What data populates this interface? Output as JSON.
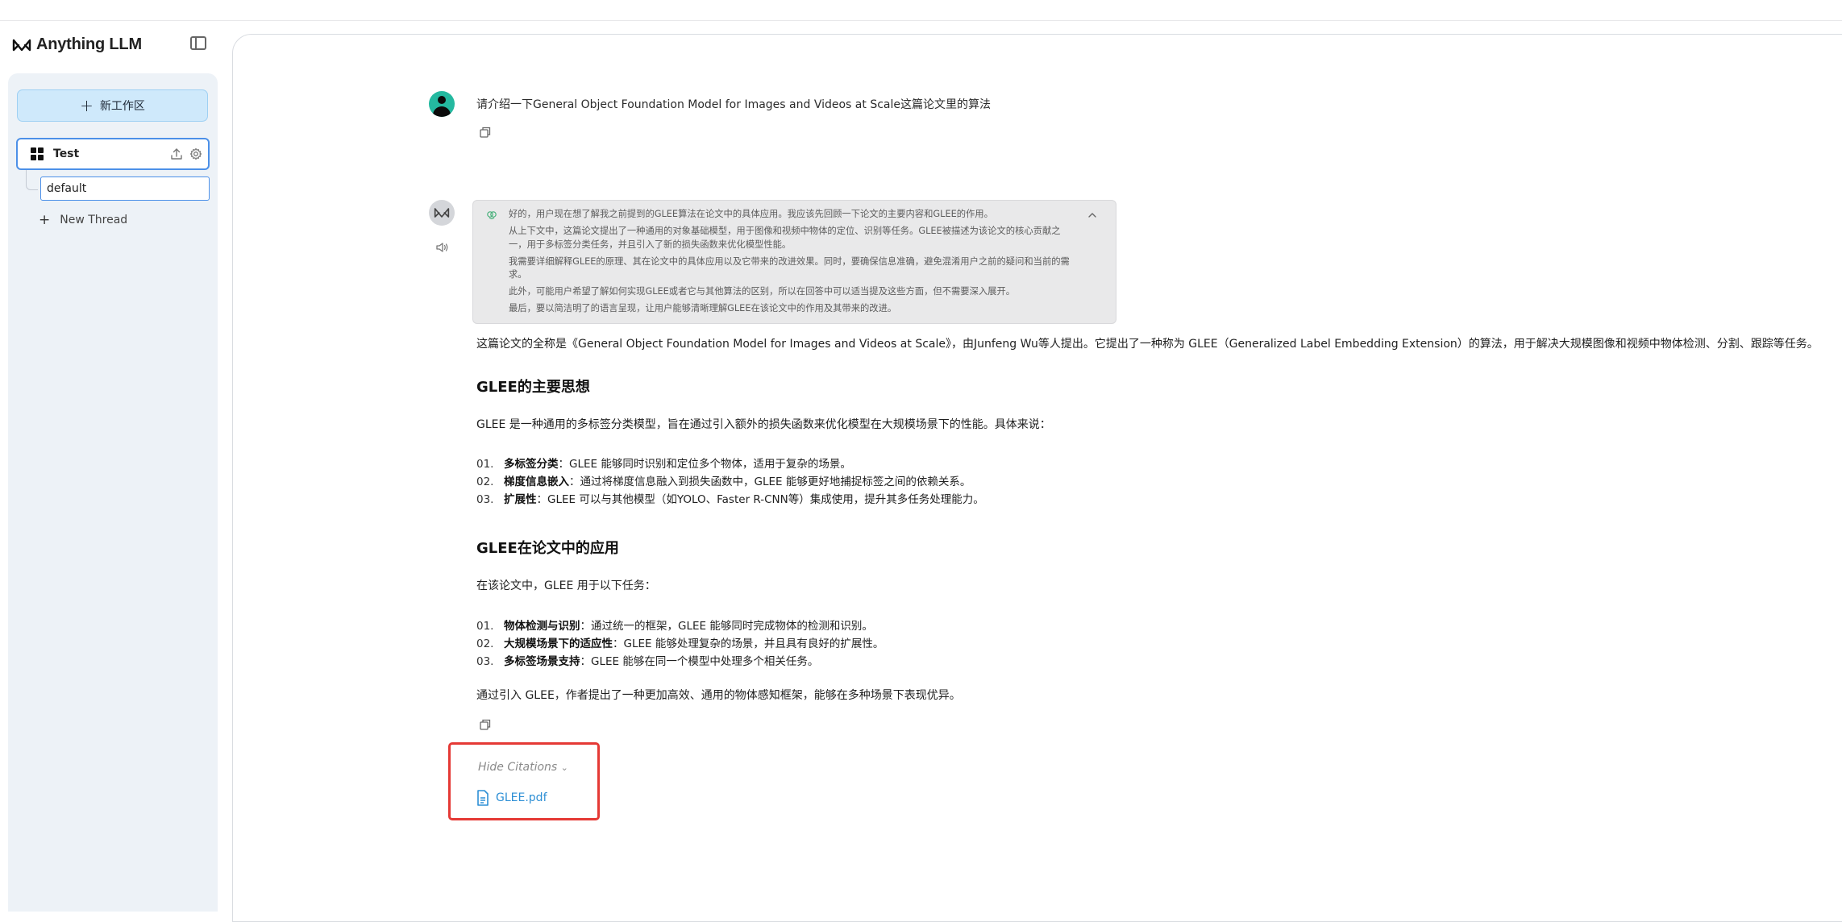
{
  "app": {
    "name": "Anything LLM"
  },
  "sidebar": {
    "new_workspace_label": "新工作区",
    "workspace": {
      "name": "Test"
    },
    "threads": [
      {
        "name": "default"
      }
    ],
    "new_thread_label": "New Thread"
  },
  "chat": {
    "user_message": "请介绍一下General Object Foundation Model for Images and Videos at Scale这篇论文里的算法",
    "thinking": [
      "好的，用户现在想了解我之前提到的GLEE算法在论文中的具体应用。我应该先回顾一下论文的主要内容和GLEE的作用。",
      "从上下文中，这篇论文提出了一种通用的对象基础模型，用于图像和视频中物体的定位、识别等任务。GLEE被描述为该论文的核心贡献之一，用于多标签分类任务，并且引入了新的损失函数来优化模型性能。",
      "我需要详细解释GLEE的原理、其在论文中的具体应用以及它带来的改进效果。同时，要确保信息准确，避免混淆用户之前的疑问和当前的需求。",
      "此外，可能用户希望了解如何实现GLEE或者它与其他算法的区别，所以在回答中可以适当提及这些方面，但不需要深入展开。",
      "最后，要以简洁明了的语言呈现，让用户能够清晰理解GLEE在该论文中的作用及其带来的改进。"
    ],
    "intro": "这篇论文的全称是《General Object Foundation Model for Images and Videos at Scale》，由Junfeng Wu等人提出。它提出了一种称为 GLEE（Generalized Label Embedding Extension）的算法，用于解决大规模图像和视频中物体检测、分割、跟踪等任务。",
    "section1": {
      "title": "GLEE的主要思想",
      "lead": "GLEE 是一种通用的多标签分类模型，旨在通过引入额外的损失函数来优化模型在大规模场景下的性能。具体来说：",
      "items": [
        {
          "num": "01.",
          "bold": "多标签分类",
          "text": "：GLEE 能够同时识别和定位多个物体，适用于复杂的场景。"
        },
        {
          "num": "02.",
          "bold": "梯度信息嵌入",
          "text": "：通过将梯度信息融入到损失函数中，GLEE 能够更好地捕捉标签之间的依赖关系。"
        },
        {
          "num": "03.",
          "bold": "扩展性",
          "text": "：GLEE 可以与其他模型（如YOLO、Faster R-CNN等）集成使用，提升其多任务处理能力。"
        }
      ]
    },
    "section2": {
      "title": "GLEE在论文中的应用",
      "lead": "在该论文中，GLEE 用于以下任务：",
      "items": [
        {
          "num": "01.",
          "bold": "物体检测与识别",
          "text": "：通过统一的框架，GLEE 能够同时完成物体的检测和识别。"
        },
        {
          "num": "02.",
          "bold": "大规模场景下的适应性",
          "text": "：GLEE 能够处理复杂的场景，并且具有良好的扩展性。"
        },
        {
          "num": "03.",
          "bold": "多标签场景支持",
          "text": "：GLEE 能够在同一个模型中处理多个相关任务。"
        }
      ]
    },
    "conclusion": "通过引入 GLEE，作者提出了一种更加高效、通用的物体感知框架，能够在多种场景下表现优异。",
    "citations": {
      "toggle_label": "Hide Citations",
      "files": [
        {
          "name": "GLEE.pdf"
        }
      ]
    }
  },
  "icons": {
    "logo": "anything-llm-logo-icon",
    "sidebar_toggle": "sidebar-toggle-icon",
    "upload": "upload-icon",
    "settings": "gear-icon",
    "copy": "copy-icon",
    "speaker": "speaker-icon",
    "thought": "brain-icon",
    "collapse": "chevron-up-icon",
    "file": "file-icon"
  },
  "colors": {
    "accent": "#4c90e8",
    "new_workspace_bg": "#cfe9fb",
    "sidebar_bg": "#edf2f7",
    "citation_highlight": "#e53935",
    "link": "#2d8fd5",
    "user_avatar": "#24b9a0"
  }
}
